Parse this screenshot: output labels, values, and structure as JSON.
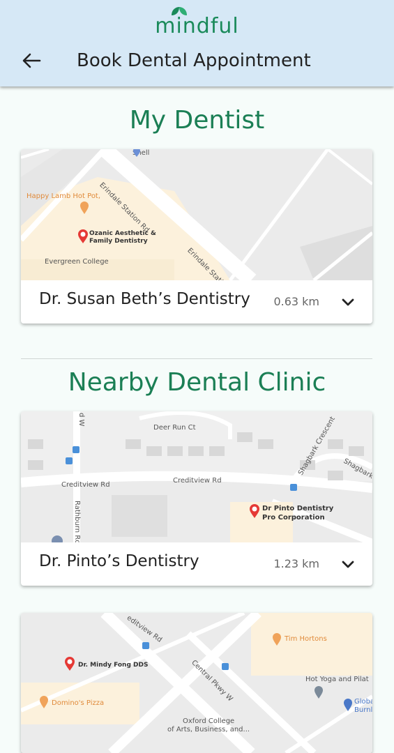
{
  "header": {
    "logo_text": "mindful",
    "title": "Book Dental Appointment",
    "back_icon": "arrow-left-icon",
    "background": "#d6e8f6"
  },
  "sections": {
    "my_dentist": "My Dentist",
    "nearby": "Nearby Dental Clinic"
  },
  "cards": [
    {
      "name": "Dr. Susan Beth’s Dentistry",
      "distance": "0.63 km",
      "map": {
        "labels": {
          "shell": "Shell",
          "happy_lamb": "Happy Lamb Hot Pot,",
          "ozanic_1": "Ozanic Aesthetic &",
          "ozanic_2": "Family Dentistry",
          "evergreen": "Evergreen College",
          "erindale_1": "Erindale Station Rd",
          "erindale_2": "Erindale Station"
        }
      }
    },
    {
      "name": "Dr. Pinto’s Dentistry",
      "distance": "1.23 km",
      "map": {
        "labels": {
          "deer_run": "Deer Run Ct",
          "creditview_1": "Creditview Rd",
          "creditview_2": "Creditview Rd",
          "shagbark_1": "Shagbark Crescent",
          "shagbark_2": "Shagbark",
          "rathburn": "Rathburn Rd W",
          "pinto_1": "Dr Pinto Dentistry",
          "pinto_2": "Pro Corporation",
          "top_left": "d W"
        }
      }
    },
    {
      "map": {
        "labels": {
          "creditview": "editview Rd",
          "mindy": "Dr. Mindy Fong DDS",
          "central": "Central Pkwy W",
          "tim": "Tim Hortons",
          "hotyoga": "Hot Yoga and Pilat",
          "globa_1": "Globa",
          "globa_2": "Burnl",
          "dominos": "Domino's Pizza",
          "oxford_1": "Oxford College",
          "oxford_2": "of Arts, Business, and..."
        }
      }
    }
  ]
}
